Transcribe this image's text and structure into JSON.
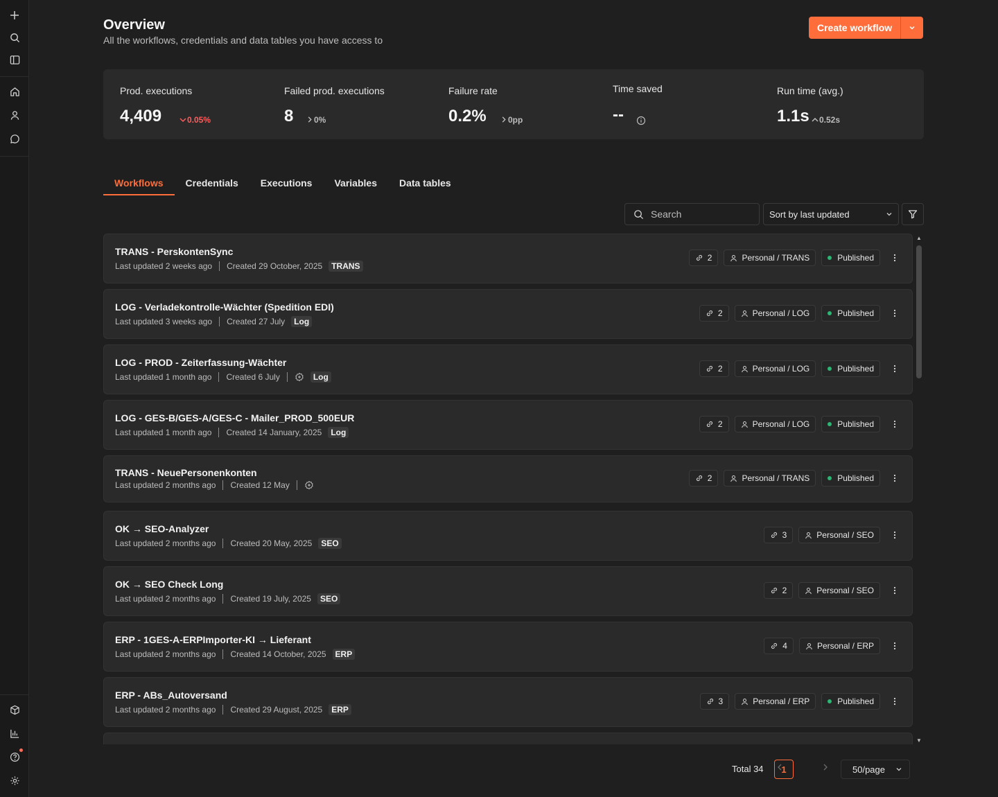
{
  "header": {
    "title": "Overview",
    "subtitle": "All the workflows, credentials and data tables you have access to",
    "create_label": "Create workflow"
  },
  "stats": [
    {
      "label": "Prod. executions",
      "value": "4,409",
      "delta": "0.05%",
      "trend": "down",
      "delta_color": "#ff5c5c"
    },
    {
      "label": "Failed prod. executions",
      "value": "8",
      "delta": "0%",
      "trend": "flat"
    },
    {
      "label": "Failure rate",
      "value": "0.2%",
      "delta": "0pp",
      "trend": "flat"
    },
    {
      "label": "Time saved",
      "value": "--",
      "delta": "",
      "trend": "info"
    },
    {
      "label": "Run time (avg.)",
      "value": "1.1s",
      "delta": "0.52s",
      "trend": "up"
    }
  ],
  "tabs": [
    "Workflows",
    "Credentials",
    "Executions",
    "Variables",
    "Data tables"
  ],
  "active_tab": 0,
  "toolbar": {
    "search_placeholder": "Search",
    "sort_label": "Sort by last updated"
  },
  "workflows": [
    {
      "name": "TRANS - PerskontenSync",
      "updated": "Last updated 2 weeks ago",
      "created": "Created 29 October, 2025",
      "extra_icon": false,
      "tag": "TRANS",
      "links": "2",
      "project": "Personal / TRANS",
      "status": "Published"
    },
    {
      "name": "LOG - Verladekontrolle-Wächter (Spedition EDI)",
      "updated": "Last updated 3 weeks ago",
      "created": "Created 27 July",
      "extra_icon": false,
      "tag": "Log",
      "links": "2",
      "project": "Personal / LOG",
      "status": "Published"
    },
    {
      "name": "LOG - PROD - Zeiterfassung-Wächter",
      "updated": "Last updated 1 month ago",
      "created": "Created 6 July",
      "extra_icon": true,
      "tag": "Log",
      "links": "2",
      "project": "Personal / LOG",
      "status": "Published"
    },
    {
      "name": "LOG - GES-B/GES-A/GES-C - Mailer_PROD_500EUR",
      "updated": "Last updated 1 month ago",
      "created": "Created 14 January, 2025",
      "extra_icon": false,
      "tag": "Log",
      "links": "2",
      "project": "Personal / LOG",
      "status": "Published"
    },
    {
      "name": "TRANS - NeuePersonenkonten",
      "updated": "Last updated 2 months ago",
      "created": "Created 12 May",
      "extra_icon": true,
      "tag": "",
      "links": "2",
      "project": "Personal / TRANS",
      "status": "Published"
    },
    {
      "name": "OK → SEO-Analyzer",
      "updated": "Last updated 2 months ago",
      "created": "Created 20 May, 2025",
      "extra_icon": false,
      "tag": "SEO",
      "links": "3",
      "project": "Personal / SEO",
      "status": ""
    },
    {
      "name": "OK → SEO Check Long",
      "updated": "Last updated 2 months ago",
      "created": "Created 19 July, 2025",
      "extra_icon": false,
      "tag": "SEO",
      "links": "2",
      "project": "Personal / SEO",
      "status": ""
    },
    {
      "name": "ERP - 1GES-A-ERPImporter-KI → Lieferant",
      "updated": "Last updated 2 months ago",
      "created": "Created 14 October, 2025",
      "extra_icon": false,
      "tag": "ERP",
      "links": "4",
      "project": "Personal / ERP",
      "status": ""
    },
    {
      "name": "ERP - ABs_Autoversand",
      "updated": "Last updated 2 months ago",
      "created": "Created 29 August, 2025",
      "extra_icon": false,
      "tag": "ERP",
      "links": "3",
      "project": "Personal / ERP",
      "status": "Published"
    }
  ],
  "pagination": {
    "total": "Total 34",
    "current": "1",
    "per_page": "50/page"
  },
  "colors": {
    "accent": "#ff6d3a",
    "published_dot": "#2bb673",
    "negative": "#ff5c5c"
  }
}
